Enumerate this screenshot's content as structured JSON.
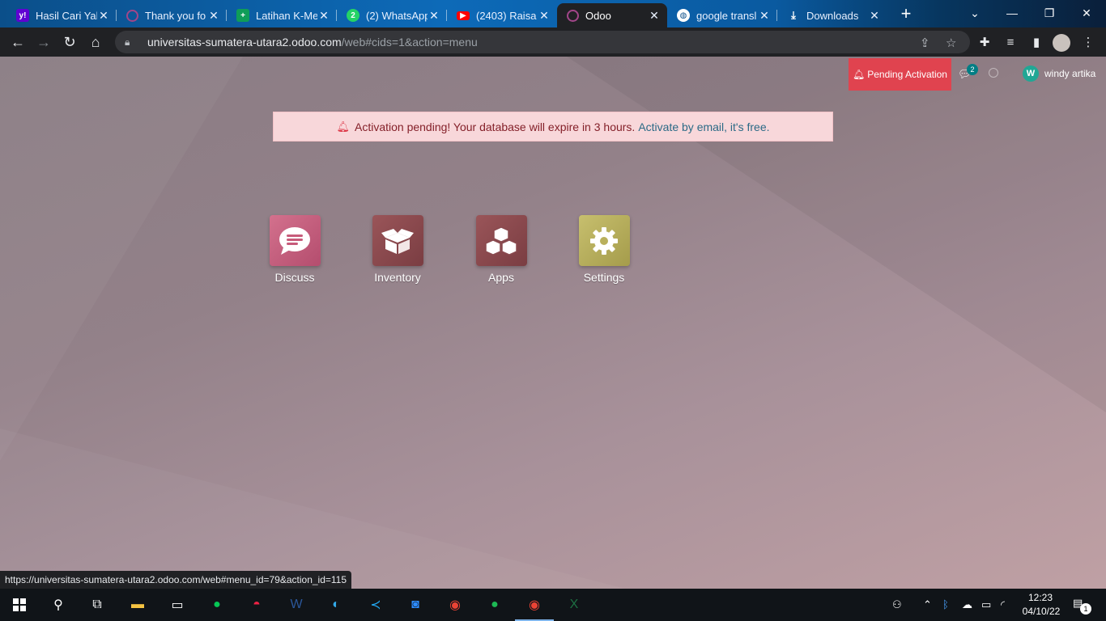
{
  "browser": {
    "tabs": [
      {
        "title": "Hasil Cari Yah",
        "icon": "yahoo-icon",
        "color": "#6001d2"
      },
      {
        "title": "Thank you fo",
        "icon": "odoo-ring-icon",
        "color": "#a24689"
      },
      {
        "title": "Latihan K-Me",
        "icon": "sheets-plus-icon",
        "color": "#0f9d58"
      },
      {
        "title": "(2) WhatsApp",
        "icon": "whatsapp-icon",
        "color": "#25d366"
      },
      {
        "title": "(2403) Raisa",
        "icon": "youtube-icon",
        "color": "#ff0000"
      },
      {
        "title": "Odoo",
        "icon": "odoo-ring-icon",
        "color": "#a24689"
      },
      {
        "title": "google transl",
        "icon": "globe-icon",
        "color": "#ffffff"
      },
      {
        "title": "Downloads",
        "icon": "download-icon",
        "color": "#ffffff"
      }
    ],
    "active_tab": 5,
    "new_tab": "+",
    "address": {
      "host": "universitas-sumatera-utara2.odoo.com",
      "path": "/web#cids=1&action=menu"
    },
    "status_url": "https://universitas-sumatera-utara2.odoo.com/web#menu_id=79&action_id=115"
  },
  "odoo": {
    "systray": {
      "pending_label": "Pending Activation",
      "chat_count": "2",
      "user_initial": "W",
      "user_name": "windy artika"
    },
    "alert": {
      "text": "Activation pending! Your database will expire in 3 hours.",
      "link": "Activate by email, it's free."
    },
    "apps": [
      {
        "label": "Discuss",
        "icon": "chat-bubble-icon",
        "color": "#c75b7a"
      },
      {
        "label": "Inventory",
        "icon": "open-box-icon",
        "color": "#8a4a4f"
      },
      {
        "label": "Apps",
        "icon": "cubes-icon",
        "color": "#8a4a4f"
      },
      {
        "label": "Settings",
        "icon": "gear-icon",
        "color": "#b9b05c"
      }
    ]
  },
  "taskbar": {
    "time": "12:23",
    "date": "04/10/22",
    "notifications": "1"
  }
}
